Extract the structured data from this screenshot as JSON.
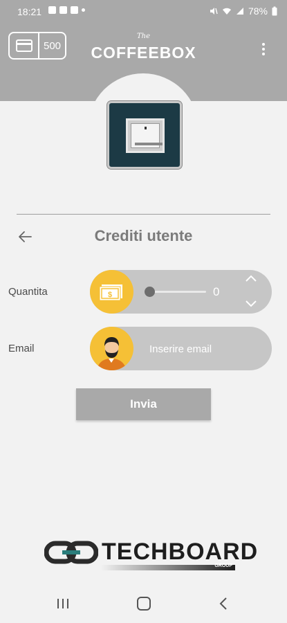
{
  "status_bar": {
    "time": "18:21",
    "battery": "78%"
  },
  "header": {
    "credit_value": "500",
    "brand_small": "The",
    "brand": "COFFEEBOX"
  },
  "page": {
    "title": "Crediti utente"
  },
  "form": {
    "quantity_label": "Quantita",
    "quantity_value": "0",
    "email_label": "Email",
    "email_placeholder": "Inserire email",
    "send_label": "Invia"
  },
  "footer": {
    "brand": "TECHBOARD",
    "brand_sub": "GROUP"
  },
  "colors": {
    "header": "#a9a9a9",
    "background": "#f2f2f2",
    "accent": "#f5c036",
    "pill": "#c6c6c6",
    "machine": "#1c3a45"
  },
  "icons": [
    "wallet-icon",
    "card-icon",
    "menu-dots-icon",
    "back-arrow-icon",
    "money-icon",
    "user-avatar-icon",
    "chevron-up-icon",
    "chevron-down-icon"
  ]
}
